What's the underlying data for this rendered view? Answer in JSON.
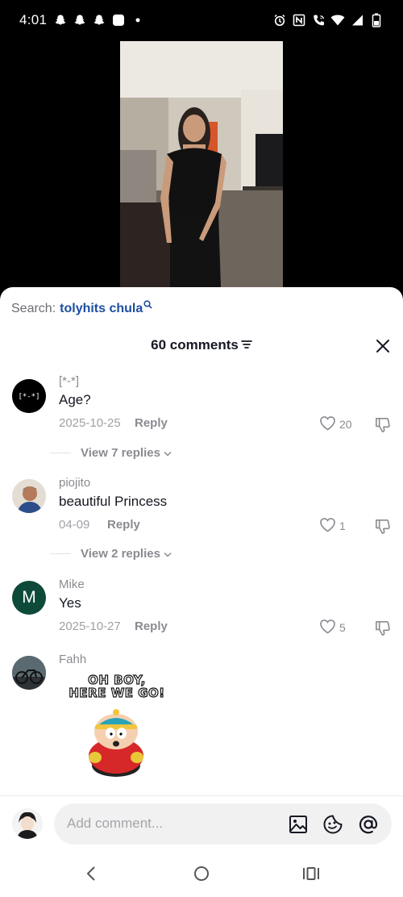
{
  "status_bar": {
    "time": "4:01",
    "left_icons": [
      "snapchat-icon",
      "snapchat-icon",
      "snapchat-icon",
      "app-icon",
      "dot-icon"
    ],
    "right_icons": [
      "alarm-icon",
      "nfc-icon",
      "wifi-calling-icon",
      "wifi-icon",
      "signal-icon",
      "battery-icon"
    ]
  },
  "search": {
    "prefix": "Search:",
    "term": "tolyhits chula"
  },
  "header": {
    "title": "60 comments"
  },
  "comments": [
    {
      "user": "[*-*]",
      "text": "Age?",
      "date": "2025-10-25",
      "reply_label": "Reply",
      "likes": "20",
      "view_replies": "View 7 replies"
    },
    {
      "user": "piojito",
      "text": "beautiful Princess",
      "date": "04-09",
      "reply_label": "Reply",
      "likes": "1",
      "view_replies": "View 2 replies"
    },
    {
      "user": "Mike",
      "avatar_letter": "M",
      "text": "Yes",
      "date": "2025-10-27",
      "reply_label": "Reply",
      "likes": "5"
    },
    {
      "user": "Fahh",
      "sticker_text": [
        "OH BOY,",
        "HERE WE GO!"
      ]
    }
  ],
  "input": {
    "placeholder": "Add comment..."
  },
  "colors": {
    "accent_link": "#1d4fa0",
    "mike_avatar": "#0e4a3a",
    "text": "#161823",
    "muted": "#8a8b91"
  }
}
